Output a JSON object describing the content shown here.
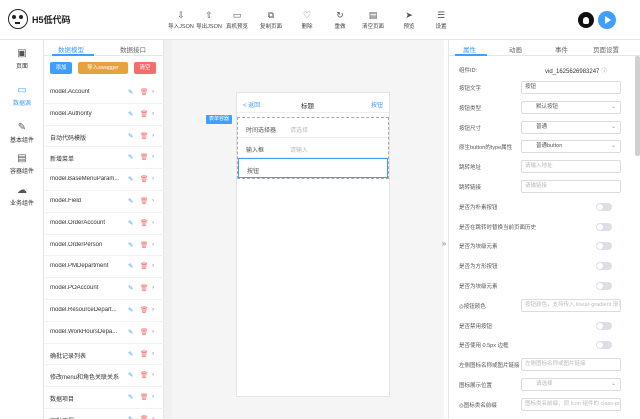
{
  "app": {
    "title": "H5低代码"
  },
  "toolbar": [
    {
      "icon": "import-icon",
      "glyph": "⇩",
      "label": "导入JSON"
    },
    {
      "icon": "export-icon",
      "glyph": "⇧",
      "label": "导出JSON"
    },
    {
      "icon": "preview-icon",
      "glyph": "▭",
      "label": "真机预览"
    },
    {
      "icon": "copy-icon",
      "glyph": "⧉",
      "label": "复制页面"
    },
    {
      "icon": "delete-icon",
      "glyph": "♡",
      "label": "删除"
    },
    {
      "icon": "reset-icon",
      "glyph": "↻",
      "label": "重做"
    },
    {
      "icon": "clear-icon",
      "glyph": "▤",
      "label": "清空页面"
    },
    {
      "icon": "send-icon",
      "glyph": "➤",
      "label": "预览"
    },
    {
      "icon": "settings-icon",
      "glyph": "☰",
      "label": "设置"
    }
  ],
  "leftnav": [
    {
      "icon": "page-icon",
      "glyph": "▣",
      "label": "页面"
    },
    {
      "icon": "datasource-icon",
      "glyph": "▭",
      "label": "数据源"
    },
    {
      "icon": "basic-component-icon",
      "glyph": "✎",
      "label": "基本组件"
    },
    {
      "icon": "container-component-icon",
      "glyph": "▤",
      "label": "容器组件"
    },
    {
      "icon": "business-component-icon",
      "glyph": "☁",
      "label": "业务组件"
    }
  ],
  "modelpanel": {
    "tabs": [
      "数据模型",
      "数据接口"
    ],
    "buttons": {
      "add": "添加",
      "import_swagger": "导入swagger",
      "clear": "清空"
    },
    "items": [
      "model.Account",
      "model.Authority",
      "自动代码模版",
      "新增菜单",
      "model.BaseMenuParam...",
      "model.Field",
      "model.OrderAccount",
      "model.OrderPerson",
      "model.PMDepartment",
      "model.POAccount",
      "model.ResourceDepart...",
      "model.WorkHoursDepa...",
      "确批记录列表",
      "修改menu和角色关联关系",
      "数据项目",
      "审批流程"
    ]
  },
  "canvas": {
    "nav": {
      "back": "< 返回",
      "title": "标题",
      "right": "按钮"
    },
    "badge": "表单容器",
    "form_rows": [
      {
        "label": "时间选择器",
        "placeholder": "请选择"
      },
      {
        "label": "输入框",
        "placeholder": "请输入"
      }
    ],
    "button_row": {
      "label": "按钮"
    }
  },
  "prop": {
    "tabs": [
      "属性",
      "动画",
      "事件",
      "页面设置"
    ],
    "component_id_label": "组件ID:",
    "component_id_value": "vid_1625626983247",
    "rows": [
      {
        "kind": "input",
        "label": "按钮文字",
        "value": "按钮"
      },
      {
        "kind": "select",
        "label": "按钮类型",
        "value": "默认按钮"
      },
      {
        "kind": "select",
        "label": "按钮尺寸",
        "value": "普通"
      },
      {
        "kind": "select",
        "label": "原生button的type属性",
        "value": "普通button"
      },
      {
        "kind": "input-ph",
        "label": "跳转地址",
        "value": "请输入地址"
      },
      {
        "kind": "input-ph",
        "label": "跳转链接",
        "value": "请输链接"
      },
      {
        "kind": "switch",
        "label": "是否为朴素按钮"
      },
      {
        "kind": "switch",
        "label": "是否在跳转时替换当前页面历史"
      },
      {
        "kind": "switch",
        "label": "是否为块级元素"
      },
      {
        "kind": "switch",
        "label": "是否为方形按钮"
      },
      {
        "kind": "switch",
        "label": "是否为块级元素"
      },
      {
        "kind": "input-ph",
        "label": "◎按钮颜色",
        "value": "按钮颜色，支持传入 linear-gradient 渐变色"
      },
      {
        "kind": "switch",
        "label": "是否禁用按钮"
      },
      {
        "kind": "switch",
        "label": "是否使用 0.5px 边框"
      },
      {
        "kind": "input-ph",
        "label": "左侧图标名称或图片链接",
        "value": "左侧图标名称或图片链接"
      },
      {
        "kind": "select-ph",
        "label": "图标展示位置",
        "value": "请选择"
      },
      {
        "kind": "input-ph",
        "label": "◎图标类名前缀",
        "value": "图标类名前缀，同 Icon 组件的 class-pref"
      }
    ]
  }
}
